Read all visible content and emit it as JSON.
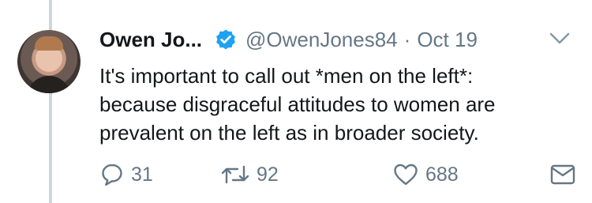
{
  "tweet": {
    "author_name": "Owen Jo...",
    "handle": "@OwenJones84",
    "separator": "·",
    "date": "Oct 19",
    "lines": [
      "It's important to call out *men on the left*:",
      "because disgraceful attitudes to women are",
      "prevalent on the left as in broader society."
    ]
  },
  "actions": {
    "replies": "31",
    "retweets": "92",
    "likes": "688"
  },
  "icons": {
    "verified": "verified-badge-icon",
    "menu": "chevron-down-icon",
    "reply": "reply-icon",
    "retweet": "retweet-icon",
    "like": "heart-icon",
    "dm": "direct-message-icon"
  },
  "colors": {
    "verified": "#1da1f2",
    "muted": "#657786",
    "text": "#14171a"
  }
}
